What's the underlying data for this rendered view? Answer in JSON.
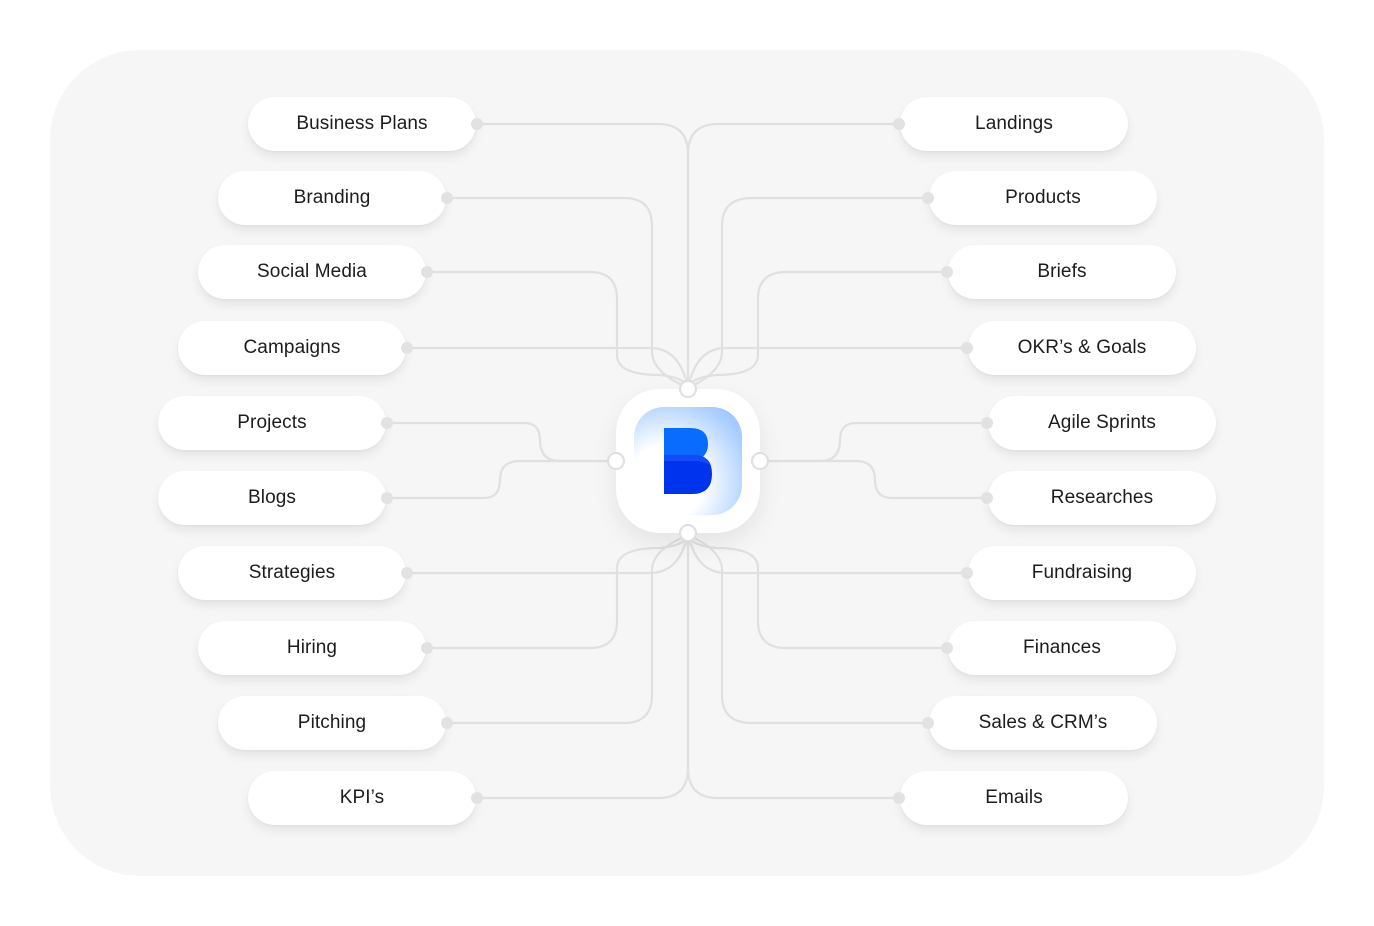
{
  "diagram": {
    "type": "mind-map",
    "hub": {
      "label": "B",
      "icon": "b-logo-icon",
      "brand_color": "#0a5cff",
      "brand_color_dark": "#0033e6"
    },
    "left_nodes": [
      {
        "label": "Business Plans"
      },
      {
        "label": "Branding"
      },
      {
        "label": "Social Media"
      },
      {
        "label": "Campaigns"
      },
      {
        "label": "Projects"
      },
      {
        "label": "Blogs"
      },
      {
        "label": "Strategies"
      },
      {
        "label": "Hiring"
      },
      {
        "label": "Pitching"
      },
      {
        "label": "KPI’s"
      }
    ],
    "right_nodes": [
      {
        "label": "Landings"
      },
      {
        "label": "Products"
      },
      {
        "label": "Briefs"
      },
      {
        "label": "OKR’s & Goals"
      },
      {
        "label": "Agile Sprints"
      },
      {
        "label": "Researches"
      },
      {
        "label": "Fundraising"
      },
      {
        "label": "Finances"
      },
      {
        "label": "Sales & CRM’s"
      },
      {
        "label": "Emails"
      }
    ],
    "colors": {
      "panel": "#f6f6f6",
      "wire": "#e0e0e0",
      "node": "#ffffff",
      "text": "#1c1c1c"
    }
  }
}
